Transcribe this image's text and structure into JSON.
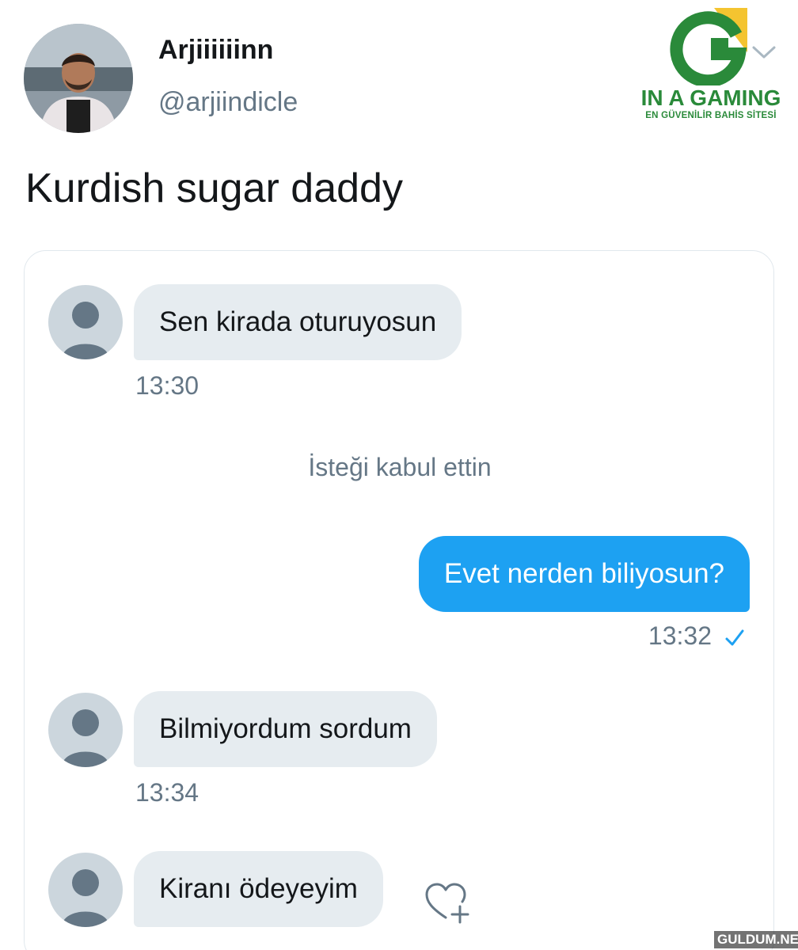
{
  "tweet": {
    "display_name": "Arjiiiiiinn",
    "handle": "@arjiindicle",
    "text": "Kurdish sugar daddy"
  },
  "watermark": {
    "brand": "IN A GAMING",
    "tagline": "EN GÜVENİLİR BAHİS SİTESİ",
    "site": "GULDUM.NET"
  },
  "dm": {
    "messages": [
      {
        "direction": "incoming",
        "text": "Sen kirada oturuyosun",
        "time": "13:30"
      },
      {
        "direction": "system",
        "text": "İsteği kabul ettin"
      },
      {
        "direction": "outgoing",
        "text": "Evet nerden biliyosun?",
        "time": "13:32",
        "status_icon": "check-icon"
      },
      {
        "direction": "incoming",
        "text": "Bilmiyordum sordum",
        "time": "13:34"
      },
      {
        "direction": "incoming",
        "text": "Kiranı ödeyeyim",
        "reaction_icon": "heart-add-icon"
      }
    ]
  },
  "colors": {
    "accent": "#1da1f2",
    "incoming_bubble": "#e6ecf0",
    "muted_text": "#657786",
    "watermark_green": "#2a8a3a",
    "watermark_yellow": "#f4c430"
  }
}
